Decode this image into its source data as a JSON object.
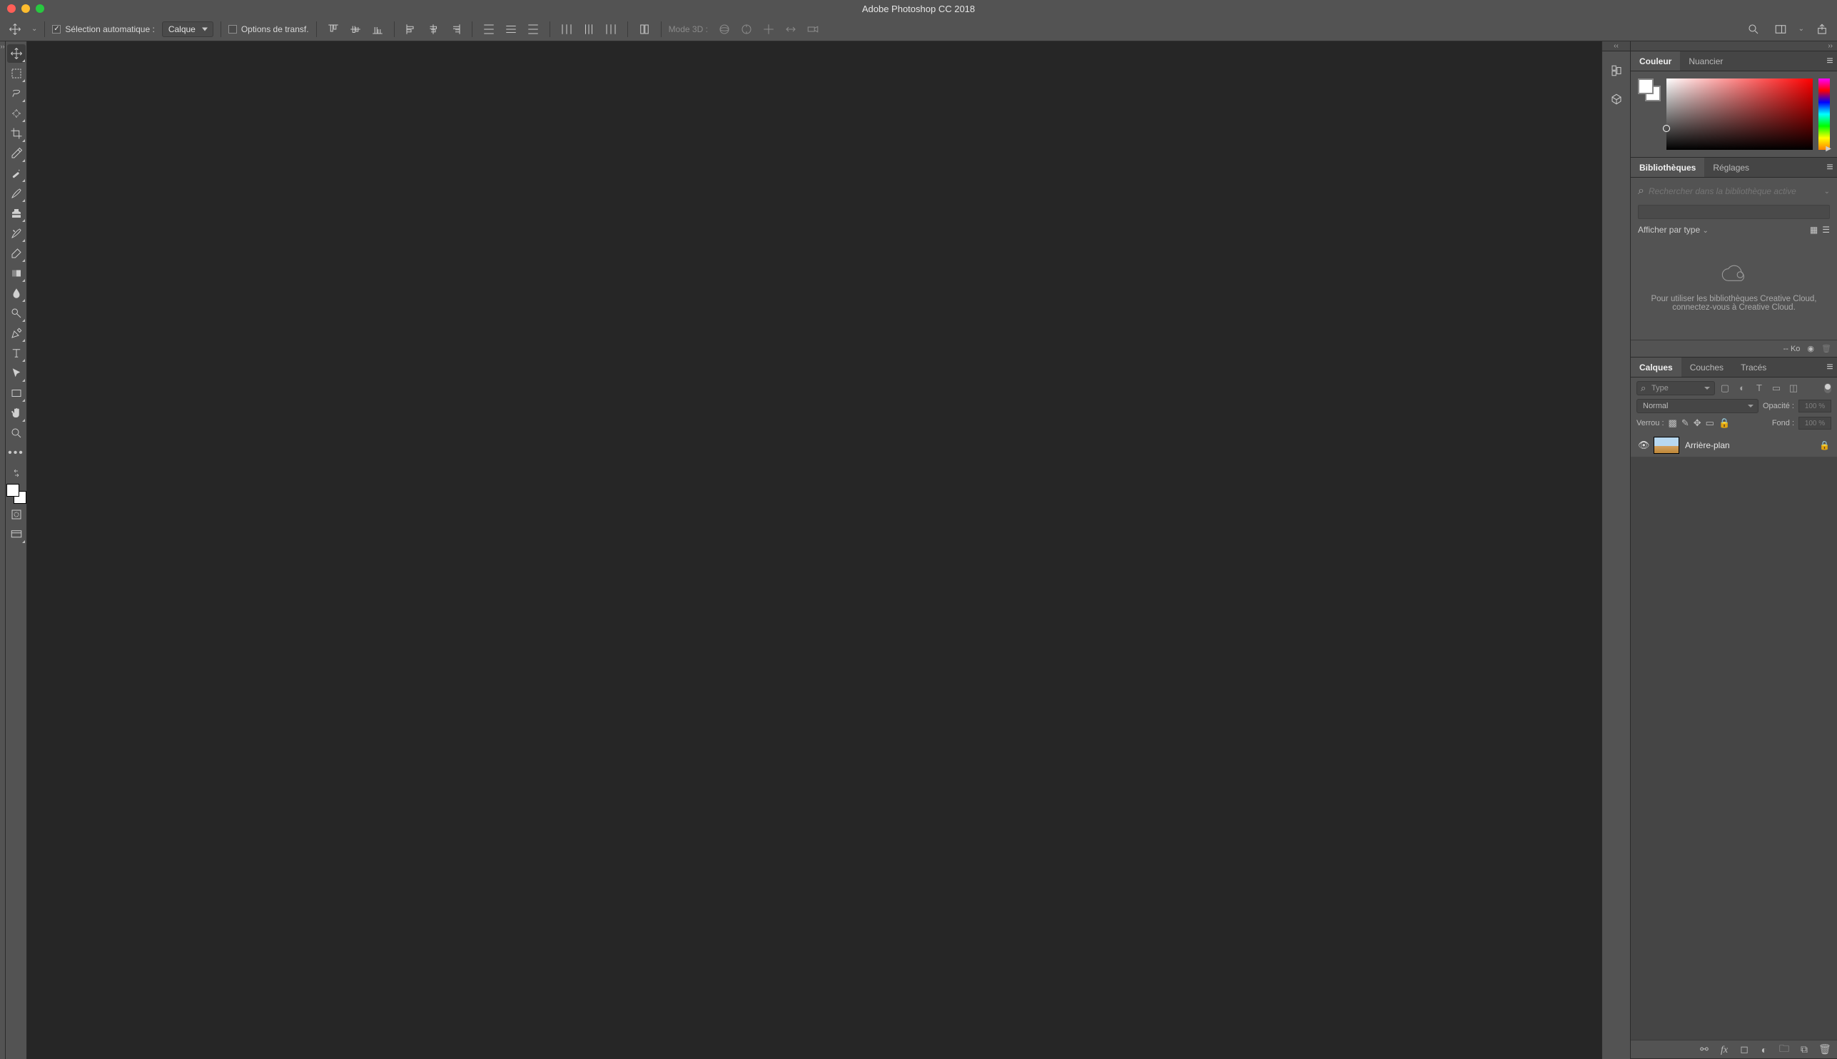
{
  "titlebar": {
    "title": "Adobe Photoshop CC 2018"
  },
  "optionsbar": {
    "auto_select_checked": true,
    "auto_select_label": "Sélection automatique :",
    "auto_select_target": "Calque",
    "transform_checked": false,
    "transform_label": "Options de transf.",
    "mode3d_label": "Mode 3D :"
  },
  "panels": {
    "color": {
      "tab_color": "Couleur",
      "tab_swatches": "Nuancier"
    },
    "libraries": {
      "tab_lib": "Bibliothèques",
      "tab_adjust": "Réglages",
      "search_placeholder": "Rechercher dans la bibliothèque active",
      "filter_label": "Afficher par type",
      "empty_line1": "Pour utiliser les bibliothèques Creative Cloud,",
      "empty_line2": "connectez-vous à Creative Cloud.",
      "size_label": "-- Ko"
    },
    "layers": {
      "tab_layers": "Calques",
      "tab_channels": "Couches",
      "tab_paths": "Tracés",
      "kind_label": "Type",
      "blend_mode": "Normal",
      "opacity_label": "Opacité :",
      "opacity_value": "100 %",
      "lock_label": "Verrou :",
      "fill_label": "Fond :",
      "fill_value": "100 %",
      "items": [
        {
          "name": "Arrière-plan",
          "locked": true,
          "visible": true
        }
      ]
    }
  }
}
